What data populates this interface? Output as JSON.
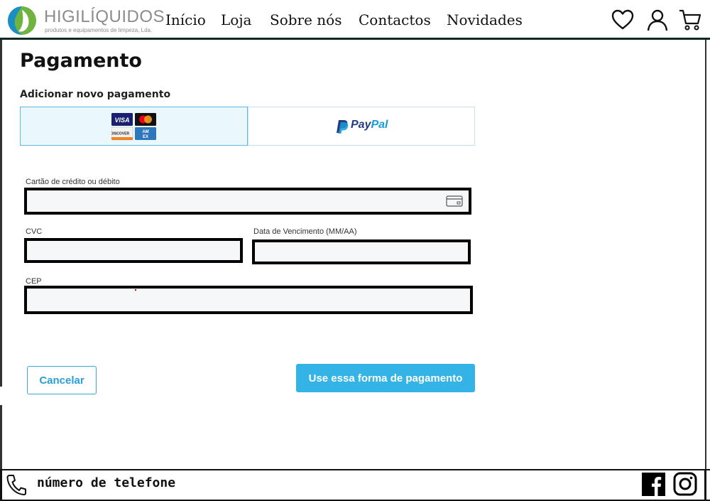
{
  "header": {
    "logo": {
      "name": "HIGILÍQUIDOS",
      "subtitle": "produtos e equipamentos de limpeza, Lda."
    },
    "nav": [
      "Início",
      "Loja",
      "Sobre nós",
      "Contactos",
      "Novidades"
    ],
    "icons": [
      "heart-icon",
      "user-icon",
      "cart-icon"
    ]
  },
  "main": {
    "title": "Pagamento",
    "section_label": "Adicionar novo pagamento",
    "payment_options": [
      {
        "name": "cards",
        "logos": [
          "VISA",
          "mastercard",
          "DISCOVER",
          "AMEX"
        ],
        "selected": true
      },
      {
        "name": "paypal",
        "label": "PayPal",
        "selected": false
      }
    ],
    "fields": {
      "card": {
        "label": "Cartão de crédito ou débito",
        "value": ""
      },
      "cvc": {
        "label": "CVC",
        "value": ""
      },
      "expiry": {
        "label": "Data de Vencimento (MM/AA)",
        "value": ""
      },
      "cep": {
        "label": "CEP",
        "value": ""
      }
    },
    "buttons": {
      "cancel": "Cancelar",
      "submit": "Use essa forma de pagamento"
    }
  },
  "footer": {
    "phone_label": "número de telefone",
    "social": [
      "facebook-icon",
      "instagram-icon"
    ]
  },
  "colors": {
    "accent": "#33b3e6",
    "accent_text": "#2a9fd6",
    "selected_bg": "#eaf7fd",
    "logo_green": "#6fb43f",
    "logo_blue": "#1b8fc5",
    "paypal_dark": "#253b80",
    "paypal_light": "#179bd7"
  }
}
